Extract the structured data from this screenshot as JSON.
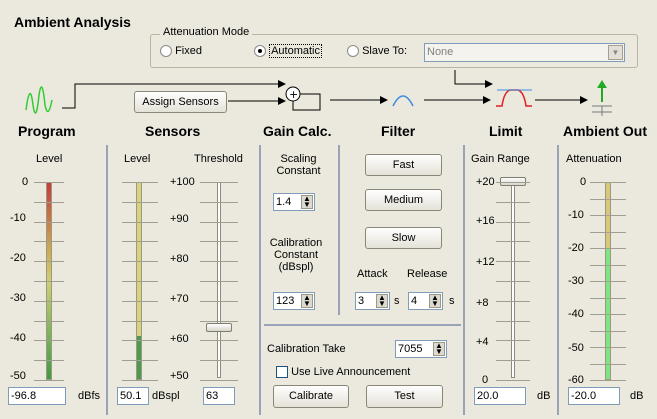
{
  "app": {
    "title": "Ambient Analysis"
  },
  "attenuation_mode": {
    "legend": "Attenuation Mode",
    "options": [
      "Fixed",
      "Automatic",
      "Slave To:"
    ],
    "selected": "Automatic",
    "slave_value": "None"
  },
  "assign_sensors_label": "Assign Sensors",
  "sections": {
    "program": "Program",
    "sensors": "Sensors",
    "gain_calc": "Gain Calc.",
    "filter": "Filter",
    "limit": "Limit",
    "ambient_out": "Ambient Out"
  },
  "program": {
    "level_label": "Level",
    "scale": [
      "0",
      "-10",
      "-20",
      "-30",
      "-40",
      "-50"
    ],
    "value": "-96.8",
    "unit": "dBfs",
    "level_fraction": 0.62
  },
  "sensors": {
    "level_label": "Level",
    "threshold_label": "Threshold",
    "scale": [
      "+100",
      "+90",
      "+80",
      "+70",
      "+60",
      "+50"
    ],
    "level_value": "50.1",
    "level_unit": "dBspl",
    "threshold_value": "63",
    "level_fraction": 0.22
  },
  "gain_calc": {
    "scaling_label_1": "Scaling",
    "scaling_label_2": "Constant",
    "scaling_value": "1.4",
    "calib_label_1": "Calibration",
    "calib_label_2": "Constant",
    "calib_label_3": "(dBspl)",
    "calib_value": "123",
    "calibration_take_label": "Calibration Take",
    "calibration_take_value": "7055",
    "use_live_label": "Use Live Announcement",
    "calibrate_label": "Calibrate",
    "test_label": "Test"
  },
  "filter": {
    "fast": "Fast",
    "medium": "Medium",
    "slow": "Slow",
    "attack_label": "Attack",
    "release_label": "Release",
    "attack_value": "3",
    "release_value": "4",
    "unit": "s"
  },
  "limit": {
    "gain_range_label": "Gain Range",
    "scale": [
      "+20",
      "+16",
      "+12",
      "+8",
      "+4",
      "0"
    ],
    "value": "20.0",
    "unit": "dB"
  },
  "ambient_out": {
    "attenuation_label": "Attenuation",
    "scale": [
      "0",
      "-10",
      "-20",
      "-30",
      "-40",
      "-50",
      "-60"
    ],
    "value": "-20.0",
    "unit": "dB",
    "level_fraction": 0.67
  }
}
